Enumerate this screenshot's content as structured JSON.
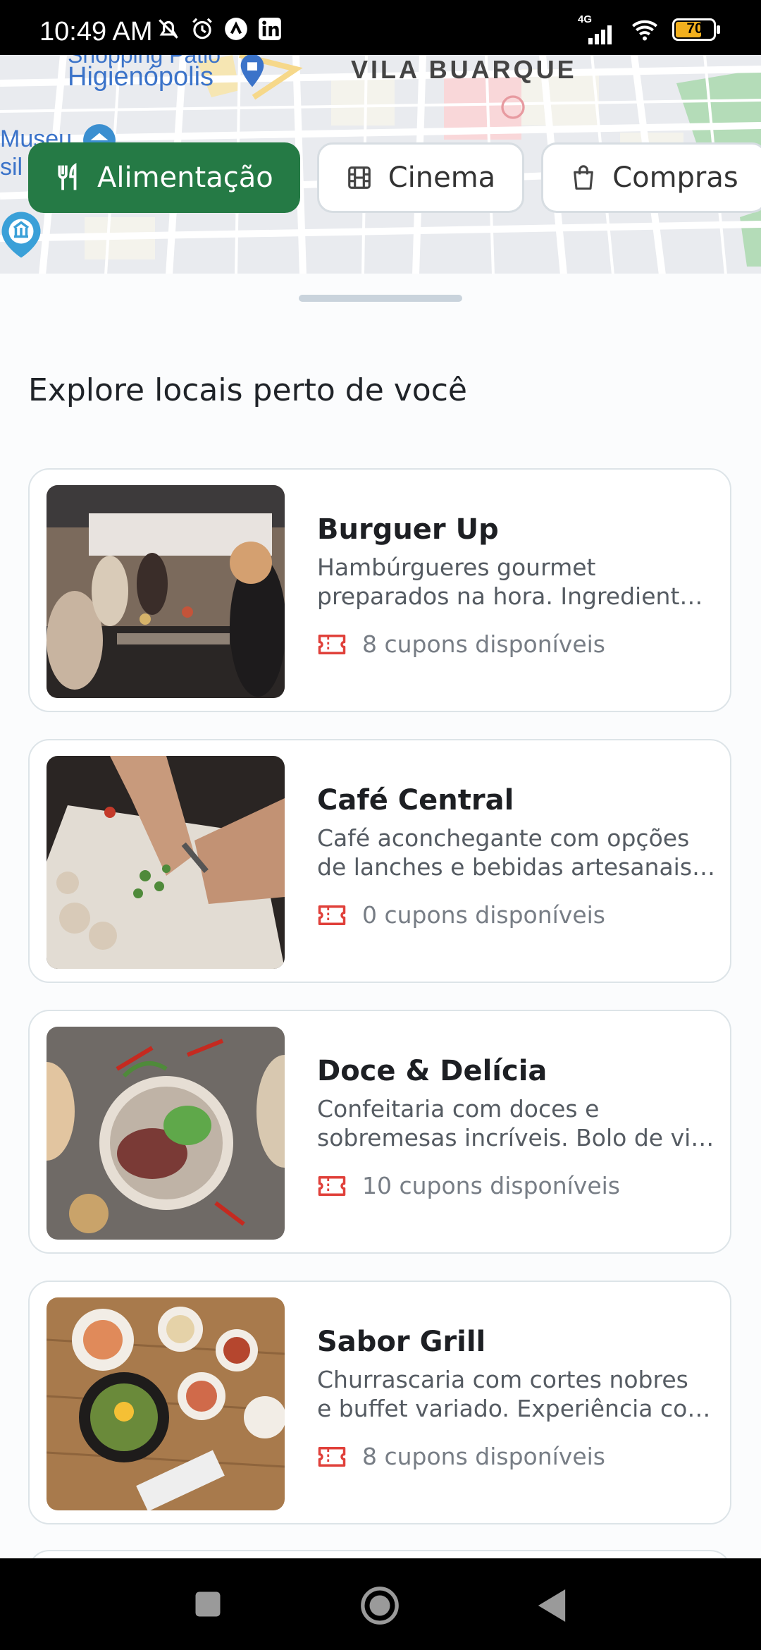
{
  "status": {
    "time": "10:49 AM",
    "network": "4G",
    "battery": "70",
    "icons": [
      "mute-icon",
      "alarm-icon",
      "vpn-icon",
      "linkedin-icon",
      "signal-icon",
      "wifi-icon",
      "battery-icon"
    ]
  },
  "map": {
    "labels": [
      "Shopping Pátio",
      "Higienópolis",
      "VILA BUARQUE",
      "Museu",
      "sil"
    ]
  },
  "categories": [
    {
      "label": "Alimentação",
      "icon": "fork-knife-icon",
      "active": true
    },
    {
      "label": "Cinema",
      "icon": "film-icon",
      "active": false
    },
    {
      "label": "Compras",
      "icon": "shopping-bag-icon",
      "active": false
    }
  ],
  "sheet": {
    "title": "Explore locais perto de você"
  },
  "places": [
    {
      "name": "Burguer Up",
      "desc1": "Hambúrgueres gourmet",
      "desc2": "preparados na hora. Ingredientes…",
      "coupons": "8 cupons disponíveis"
    },
    {
      "name": "Café Central",
      "desc1": "Café aconchegante com opções",
      "desc2": "de lanches e bebidas artesanais. …",
      "coupons": "0 cupons disponíveis"
    },
    {
      "name": "Doce & Delícia",
      "desc1": "Confeitaria com doces e",
      "desc2": "sobremesas incríveis. Bolo de vitr…",
      "coupons": "10 cupons disponíveis"
    },
    {
      "name": "Sabor Grill",
      "desc1": "Churrascaria com cortes nobres",
      "desc2": "e buffet variado. Experiência com…",
      "coupons": "8 cupons disponíveis"
    }
  ],
  "colors": {
    "accent": "#257a45",
    "coupon_icon": "#e0403a",
    "chip_border": "#d7dde2"
  }
}
